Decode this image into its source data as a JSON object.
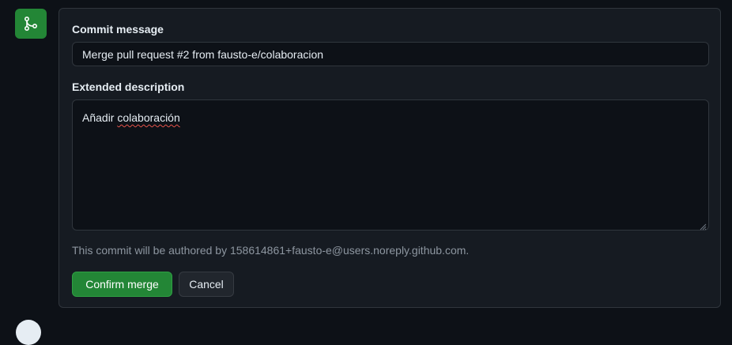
{
  "merge_form": {
    "commit_message_label": "Commit message",
    "commit_message_value": "Merge pull request #2 from fausto-e/colaboracion",
    "extended_description_label": "Extended description",
    "extended_description_word1": "Añadir",
    "extended_description_word2": "colaboración",
    "author_note": "This commit will be authored by 158614861+fausto-e@users.noreply.github.com.",
    "confirm_label": "Confirm merge",
    "cancel_label": "Cancel"
  },
  "icons": {
    "badge": "git-merge-icon"
  },
  "colors": {
    "accent_green": "#238636",
    "background": "#0d1117",
    "panel": "#161b22",
    "border": "#30363d",
    "muted_text": "#8d96a0",
    "spellcheck_underline": "#e5534b"
  }
}
